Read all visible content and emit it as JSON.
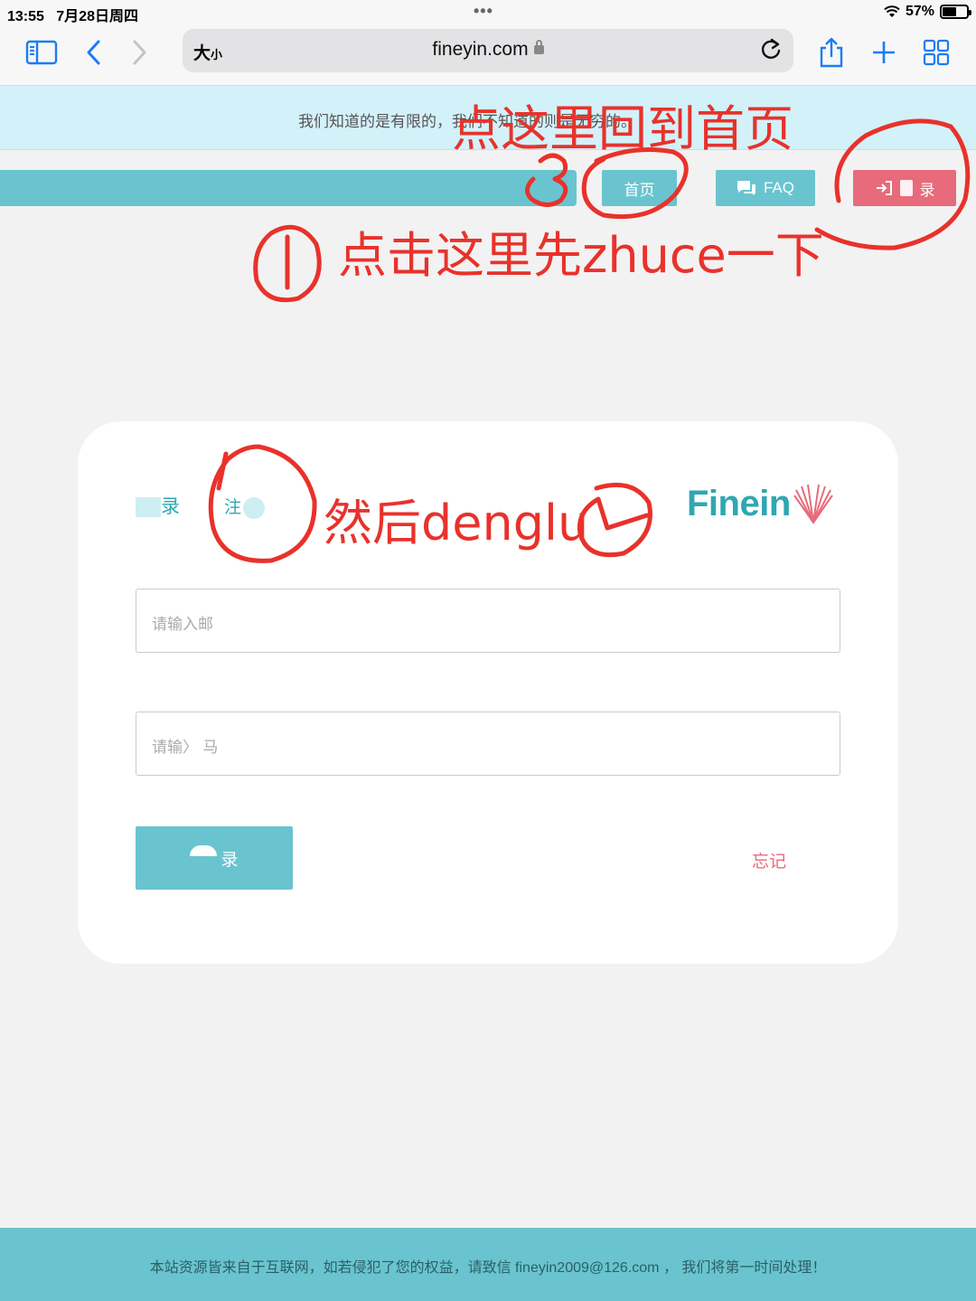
{
  "status": {
    "time": "13:55",
    "date": "7月28日周四",
    "battery": "57%",
    "battery_level": 0.57
  },
  "browser": {
    "size_big": "大",
    "size_small": "小",
    "domain": "fineyin.com"
  },
  "banner": {
    "text": "我们知道的是有限的，我们不知道的则是无穷的。"
  },
  "nav": {
    "home": "首页",
    "faq": "FAQ",
    "login": "录"
  },
  "card": {
    "tab_login": "录",
    "tab_register": "注",
    "logo_text": "Finein",
    "email_placeholder": "请输入邮",
    "password_placeholder": "请输〉  马",
    "submit": "录",
    "forgot": "忘记"
  },
  "footer": {
    "text": "本站资源皆来自于互联网，如若侵犯了您的权益，请致信 fineyin2009@126.com ， 我们将第一时间处理！"
  },
  "annotations": {
    "home_hint": "点这里回到首页",
    "register_hint": "点击这里先zhuce一下",
    "login_hint": "然后denglu",
    "colors": {
      "ink": "#e8322b",
      "accent": "#69c4cf",
      "brand_text": "#2fa7b3",
      "login_pink": "#e76b7b"
    }
  }
}
